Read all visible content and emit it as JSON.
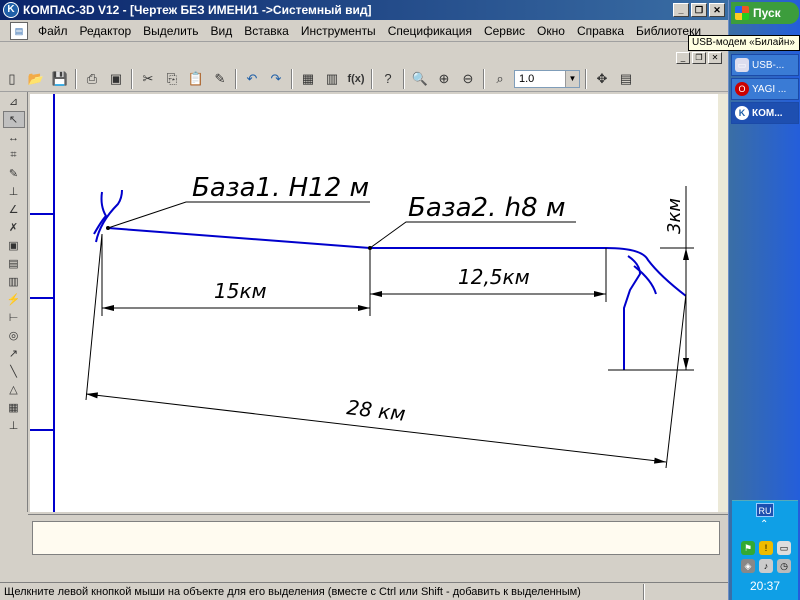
{
  "window": {
    "title": "КОМПАС-3D V12 - [Чертеж БЕЗ ИМЕНИ1 ->Системный вид]",
    "app_icon": "kompas-icon",
    "controls": [
      "_",
      "❐",
      "✕"
    ]
  },
  "menu": {
    "items": [
      "Файл",
      "Редактор",
      "Выделить",
      "Вид",
      "Вставка",
      "Инструменты",
      "Спецификация",
      "Сервис",
      "Окно",
      "Справка",
      "Библиотеки"
    ],
    "mdi_controls": [
      "_",
      "❐",
      "✕"
    ]
  },
  "toolbar": {
    "zoom_value": "1.0",
    "function_label": "f(x)",
    "icons": [
      "new-icon",
      "open-icon",
      "save-icon",
      "print-icon",
      "preview-icon",
      "cut-icon",
      "copy-icon",
      "paste-icon",
      "properties-icon",
      "undo-icon",
      "redo-icon",
      "manager-icon",
      "variables-icon",
      "function-icon",
      "help-icon",
      "zoom-window-icon",
      "zoom-in-icon",
      "zoom-out-icon",
      "zoom-scale-icon",
      "pan-icon",
      "refresh-icon"
    ]
  },
  "left_tools": [
    "geometry",
    "select",
    "dimensions",
    "notation",
    "edit",
    "parametrization",
    "measure",
    "select-tool",
    "associative-view",
    "spec",
    "report",
    "snap",
    "ortho",
    "round",
    "arrow",
    "line-tool",
    "angle",
    "table",
    "boundary"
  ],
  "drawing": {
    "base1_label": "База1. H12 м",
    "base2_label": "База2. h8 м",
    "dim_15": "15км",
    "dim_12_5": "12,5км",
    "dim_28": "28 км",
    "dim_3": "3км",
    "line_color": "#0000cc"
  },
  "status": {
    "message": "Щелкните левой кнопкой мыши на объекте для его выделения (вместе с Ctrl или Shift - добавить к выделенным)"
  },
  "taskbar": {
    "start_label": "Пуск",
    "tooltip": "USB-модем «Билайн»",
    "items": [
      {
        "label": "USB-...",
        "icon": "modem-icon"
      },
      {
        "label": "YAGI ...",
        "icon": "opera-icon"
      },
      {
        "label": "КОМ...",
        "icon": "kompas-icon"
      }
    ],
    "lang": "RU",
    "clock": "20:37"
  }
}
